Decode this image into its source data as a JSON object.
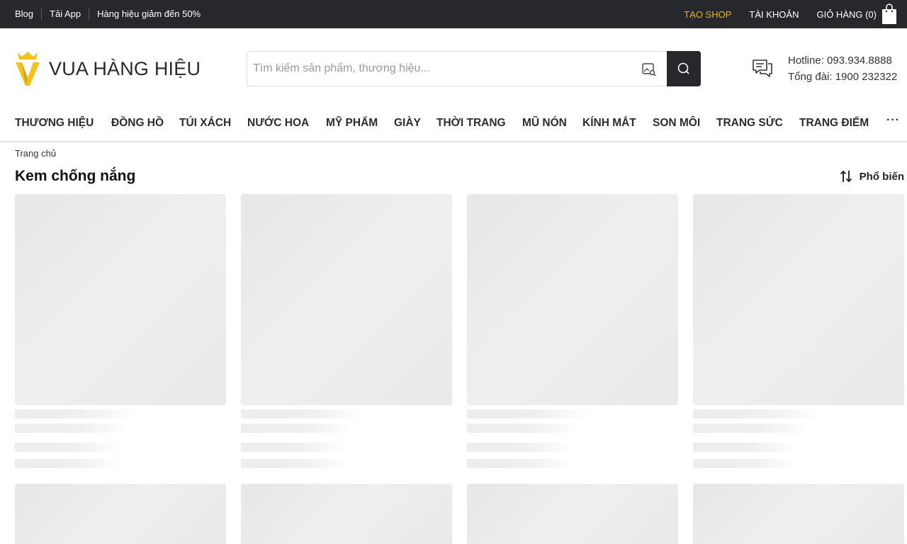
{
  "topbar": {
    "left_links": [
      "Blog",
      "Tải App",
      "Hàng hiệu giảm đến 50%"
    ],
    "shop_label": "TẠO SHOP",
    "account_label": "TÀI KHOẢN",
    "cart_label": "GIỎ HÀNG (0)"
  },
  "header": {
    "logo_text": "VUA HÀNG HIỆU",
    "search_placeholder": "Tìm kiếm sản phẩm, thương hiệu...",
    "hotline": "Hotline: 093.934.8888",
    "switchboard": "Tổng đài: 1900 232322"
  },
  "nav": {
    "items": [
      "THƯƠNG HIỆU",
      "ĐỒNG HỒ",
      "TÚI XÁCH",
      "NƯỚC HOA",
      "MỸ PHẨM",
      "GIÀY",
      "THỜI TRANG",
      "MŨ NÓN",
      "KÍNH MẮT",
      "SON MÔI",
      "TRANG SỨC",
      "TRANG ĐIỂM"
    ],
    "more_label": "···"
  },
  "breadcrumb": "Trang chủ",
  "page_title": "Kem chống nắng",
  "sort_label": "Phổ biến",
  "colors": {
    "topbar_bg": "#27282c",
    "accent": "#e3b21f",
    "skeleton": "#ebebeb"
  },
  "icons": [
    "shopping-bag-icon",
    "crown-v-logo-icon",
    "image-search-icon",
    "search-icon",
    "chat-icon",
    "sort-icon"
  ]
}
